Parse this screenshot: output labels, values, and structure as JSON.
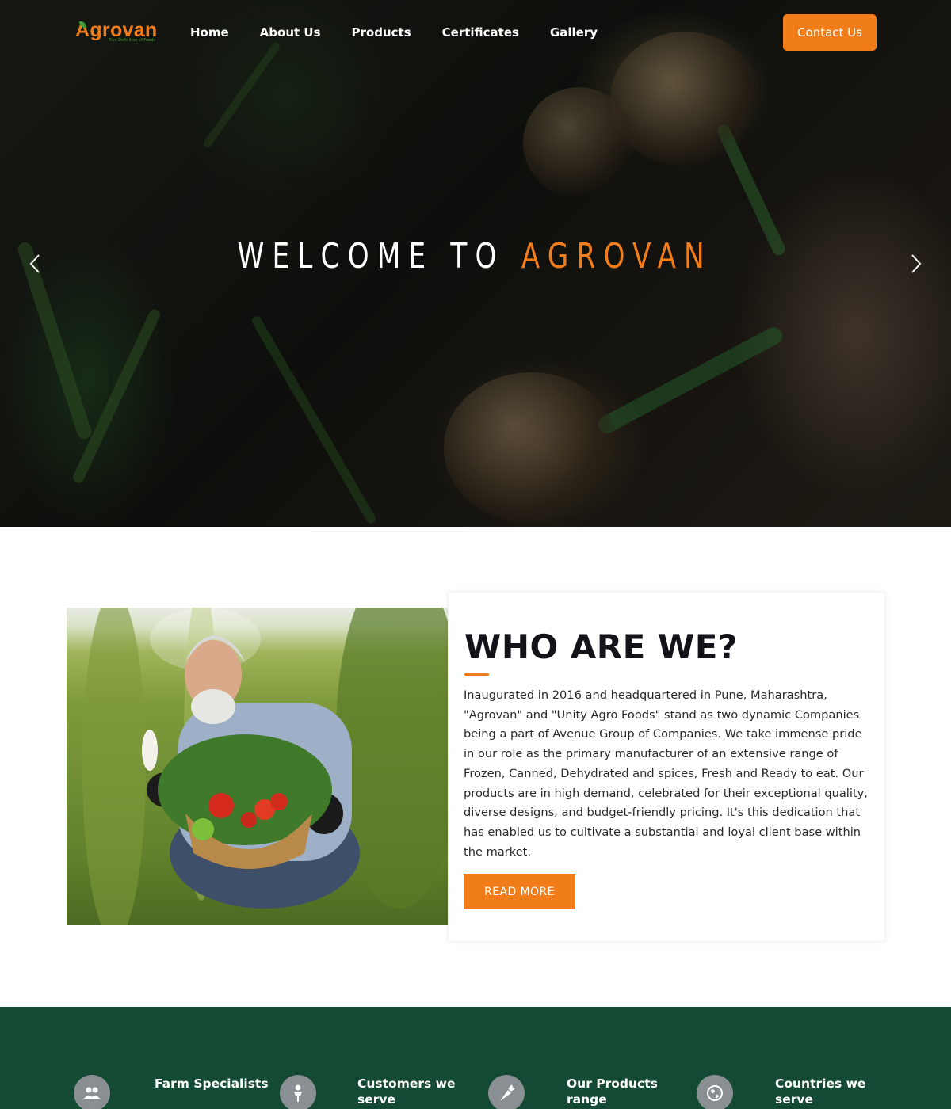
{
  "brand": {
    "name": "Agrovan",
    "tagline": "True Definition of Foods",
    "accent_color": "#f07d19",
    "dark_green": "#144a33"
  },
  "nav": {
    "items": [
      {
        "label": "Home"
      },
      {
        "label": "About Us"
      },
      {
        "label": "Products"
      },
      {
        "label": "Certificates"
      },
      {
        "label": "Gallery"
      }
    ],
    "contact_label": "Contact Us"
  },
  "hero": {
    "title_prefix": "WELCOME TO",
    "title_highlight": "AGROVAN",
    "prev_icon": "chevron-left-icon",
    "next_icon": "chevron-right-icon"
  },
  "about": {
    "title": "WHO ARE WE?",
    "body": "Inaugurated in 2016 and headquartered in Pune, Maharashtra, \"Agrovan\" and \"Unity Agro Foods\" stand as two dynamic Companies being a part of Avenue Group of Companies. We take immense pride in our role as the primary manufacturer of an extensive range of Frozen, Canned, Dehydrated and spices, Fresh and Ready to eat. Our products are in high demand, celebrated for their exceptional quality, diverse designs, and budget-friendly pricing. It's this dedication that has enabled us to cultivate a substantial and loyal client base within the market.",
    "button_label": "READ MORE"
  },
  "stats": [
    {
      "label": "Farm Specialists",
      "icon": "group-icon"
    },
    {
      "label": "Customers we serve",
      "icon": "person-icon"
    },
    {
      "label": "Our Products range",
      "icon": "carrot-icon"
    },
    {
      "label": "Countries we serve",
      "icon": "globe-icon"
    }
  ]
}
